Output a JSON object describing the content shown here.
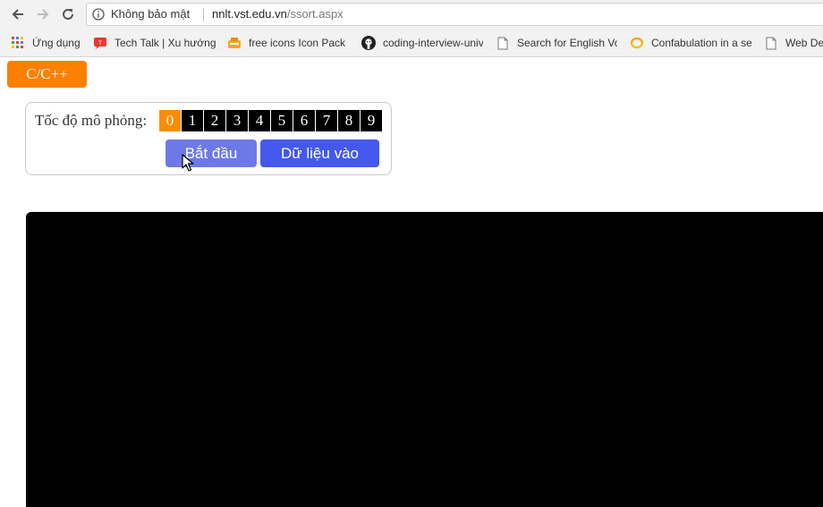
{
  "browser": {
    "security_label": "Không bảo mật",
    "url_host": "nnlt.vst.edu.vn",
    "url_path": "/ssort.aspx"
  },
  "bookmarks": [
    {
      "label": "Ứng dụng",
      "icon": "apps-grid-icon"
    },
    {
      "label": "Tech Talk | Xu hướng",
      "icon": "techtalk-icon"
    },
    {
      "label": "free icons Icon Pack (",
      "icon": "icon-pack-icon"
    },
    {
      "label": "coding-interview-univ",
      "icon": "github-icon"
    },
    {
      "label": "Search for English Vo",
      "icon": "page-icon"
    },
    {
      "label": "Confabulation in a se",
      "icon": "confab-icon"
    },
    {
      "label": "Web De",
      "icon": "page-icon"
    }
  ],
  "page": {
    "lang_button": "C/C++",
    "speed_label": "Tốc độ mô phỏng:",
    "speeds": [
      "0",
      "1",
      "2",
      "3",
      "4",
      "5",
      "6",
      "7",
      "8",
      "9"
    ],
    "active_speed": "0",
    "start_button": "Bắt đầu",
    "input_button": "Dữ liệu vào"
  },
  "colors": {
    "accent_orange": "#ff7f00",
    "start_button": "#6e79e8",
    "input_button": "#4558ee",
    "canvas": "#000000"
  }
}
